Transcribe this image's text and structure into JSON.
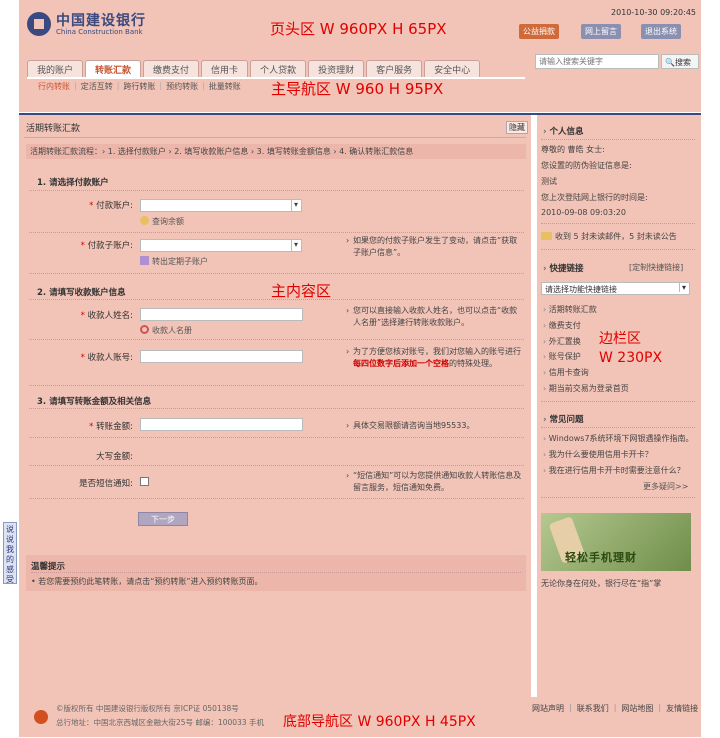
{
  "header": {
    "logo_cn": "中国建设银行",
    "logo_en": "China Construction Bank",
    "datetime": "2010-10-30  09:20:45",
    "btn_charity": "公益捐款",
    "btn_msg": "网上留言",
    "btn_logout": "退出系统",
    "annotation": "页头区 W 960PX  H 65PX"
  },
  "nav": {
    "tabs": [
      "我的账户",
      "转账汇款",
      "缴费支付",
      "信用卡",
      "个人贷款",
      "投资理财",
      "客户服务",
      "安全中心"
    ],
    "active_tab": 1,
    "search_placeholder": "请输入搜索关键字",
    "search_button": "搜索",
    "subnav": [
      "行内转账",
      "定活互转",
      "跨行转账",
      "预约转账",
      "批量转账"
    ],
    "annotation": "主导航区 W 960  H 95PX"
  },
  "main": {
    "title": "活期转账汇款",
    "hide_button": "隐藏",
    "flow": "活期转账汇款流程：› 1. 选择付款账户 › 2. 填写收款账户信息 › 3. 填写转账金额信息 › 4. 确认转账汇款信息",
    "section1": "1. 请选择付款账户",
    "label_pay_account": "付款账户:",
    "link_balance": "查询余额",
    "label_pay_sub": "付款子账户:",
    "link_time_deposit": "转出定期子账户",
    "hint_sub": "如果您的付款子账户发生了变动，请点击“获取子账户信息”。",
    "section2": "2. 请填写收款账户信息",
    "label_payee_name": "收款人姓名:",
    "link_payee_book": "收款人名册",
    "hint_payee_name": "您可以直接输入收款人姓名，也可以点击“收款人名册”选择建行转账收款账户。",
    "label_payee_acct": "收款人账号:",
    "hint_payee_acct_1": "为了方便您核对账号，我们对您输入的账号进行",
    "hint_payee_acct_red": "每四位数字后添加一个空格",
    "hint_payee_acct_2": "的特殊处理。",
    "section3": "3. 请填写转账金额及相关信息",
    "label_amount": "转账金额:",
    "hint_amount": "具体交易限额请咨询当地95533。",
    "label_amount_upper": "大写金额:",
    "label_sms": "是否短信通知:",
    "hint_sms": "“短信通知”可以为您提供通知收款人转账信息及留言服务，短信通知免费。",
    "next_button": "下一步",
    "tips_title": "温馨提示",
    "tips_text": "• 若您需要预约此笔转账，请点击“预约转账”进入预约转账页面。",
    "annotation": "主内容区"
  },
  "sidebar": {
    "personal_title": "个人信息",
    "greeting": "尊敬的 曹皓 女士:",
    "security_label": "您设置的防伪验证信息是:",
    "security_value": "测试",
    "last_login_label": "您上次登陆网上银行的时间是:",
    "last_login_value": "2010-09-08    09:03:20",
    "mail_text": "收到 5 封未读邮件，5 封未读公告",
    "quick_title": "快捷链接",
    "quick_customize": "[定制快捷链接]",
    "quick_select": "请选择功能快捷链接",
    "quick_links": [
      "活期转账汇款",
      "缴费支付",
      "外汇置换",
      "账号保护",
      "信用卡查询",
      "期当前交易为登录首页"
    ],
    "faq_title": "常见问题",
    "faq_links": [
      "Windows7系统环境下网银遇操作指南。",
      "我为什么要使用信用卡开卡？",
      "我在进行信用卡开卡时需要注意什么？"
    ],
    "faq_more": "更多疑问>>",
    "promo_text": "轻松手机理财",
    "promo_caption": "无论你身在何处，银行尽在“指”掌",
    "annotation_1": "边栏区",
    "annotation_2": "W 230PX"
  },
  "feedback": "说说我的感受",
  "footer": {
    "copy": "©版权所有  中国建设银行版权所有  京ICP证  050138号",
    "addr": "总行地址：中国北京西城区金融大街25号  邮编：100033  手机",
    "links": [
      "网站声明",
      "联系我们",
      "网站地图",
      "友情链接"
    ],
    "annotation": "底部导航区 W 960PX  H 45PX"
  }
}
